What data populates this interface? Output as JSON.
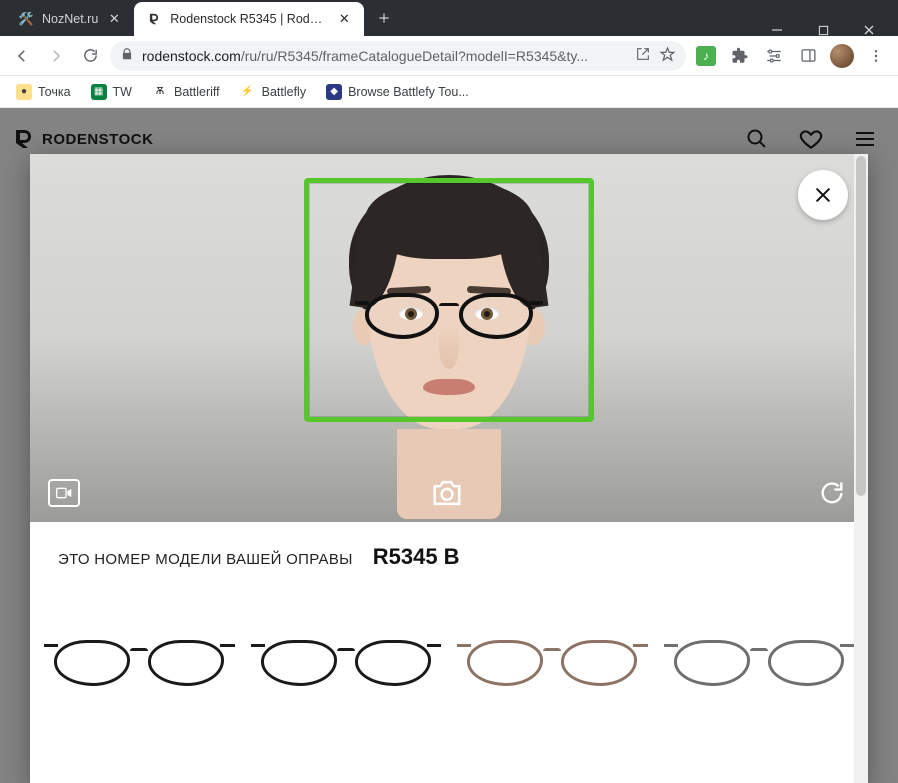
{
  "window": {
    "title": "Rodenstock R5345 | Rodenstock"
  },
  "tabs": [
    {
      "title": "NozNet.ru",
      "active": false
    },
    {
      "title": "Rodenstock R5345 | Rodenstock",
      "active": true
    }
  ],
  "toolbar": {
    "back_icon": "back",
    "forward_icon": "forward",
    "reload_icon": "reload",
    "url_host": "rodenstock.com",
    "url_path": "/ru/ru/R5345/frameCatalogueDetail?modelI=R5345&ty...",
    "share_icon": "share",
    "star_icon": "star",
    "music_ext": "♪",
    "puzzle_icon": "extensions",
    "tune_icon": "tune",
    "panel_icon": "panel",
    "menu_icon": "menu"
  },
  "bookmarks": [
    {
      "label": "Точка",
      "icon_color": "#f7b500"
    },
    {
      "label": "TW",
      "icon_color": "#0b8043"
    },
    {
      "label": "Battleriff",
      "icon_color": "#111"
    },
    {
      "label": "Battlefly",
      "icon_color": "#e24b3b"
    },
    {
      "label": "Browse Battlefy Tou...",
      "icon_color": "#3b5bd3"
    }
  ],
  "site": {
    "brand": "RODENSTOCK",
    "search_icon": "search",
    "heart_icon": "favorites",
    "menu_icon": "menu"
  },
  "modal": {
    "close_icon": "close",
    "video_icon": "video",
    "camera_icon": "camera",
    "reload_icon": "reload",
    "model_label": "ЭТО НОМЕР МОДЕЛИ ВАШЕЙ ОПРАВЫ",
    "model_code": "R5345 B",
    "variants": [
      {
        "color": "#1a1a1a"
      },
      {
        "color": "#1a1a1a"
      },
      {
        "color": "#8c7364"
      },
      {
        "color": "#6f6f6f"
      }
    ]
  }
}
